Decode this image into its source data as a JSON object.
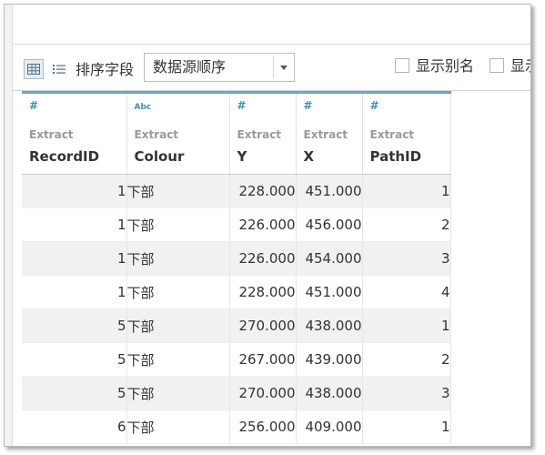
{
  "toolbar": {
    "sort_label": "排序字段",
    "sort_value": "数据源顺序",
    "show_alias_label": "显示别名",
    "show_hidden_label": "显示"
  },
  "grid": {
    "columns": [
      {
        "icon": "#",
        "source": "Extract",
        "name": "RecordID"
      },
      {
        "icon": "Abc",
        "source": "Extract",
        "name": "Colour"
      },
      {
        "icon": "#",
        "source": "Extract",
        "name": "Y"
      },
      {
        "icon": "#",
        "source": "Extract",
        "name": "X"
      },
      {
        "icon": "#",
        "source": "Extract",
        "name": "PathID"
      }
    ],
    "rows": [
      [
        "1",
        "下部",
        "228.000",
        "451.000",
        "1"
      ],
      [
        "1",
        "下部",
        "226.000",
        "456.000",
        "2"
      ],
      [
        "1",
        "下部",
        "226.000",
        "454.000",
        "3"
      ],
      [
        "1",
        "下部",
        "228.000",
        "451.000",
        "4"
      ],
      [
        "5",
        "下部",
        "270.000",
        "438.000",
        "1"
      ],
      [
        "5",
        "下部",
        "267.000",
        "439.000",
        "2"
      ],
      [
        "5",
        "下部",
        "270.000",
        "438.000",
        "3"
      ],
      [
        "6",
        "下部",
        "256.000",
        "409.000",
        "1"
      ]
    ]
  }
}
